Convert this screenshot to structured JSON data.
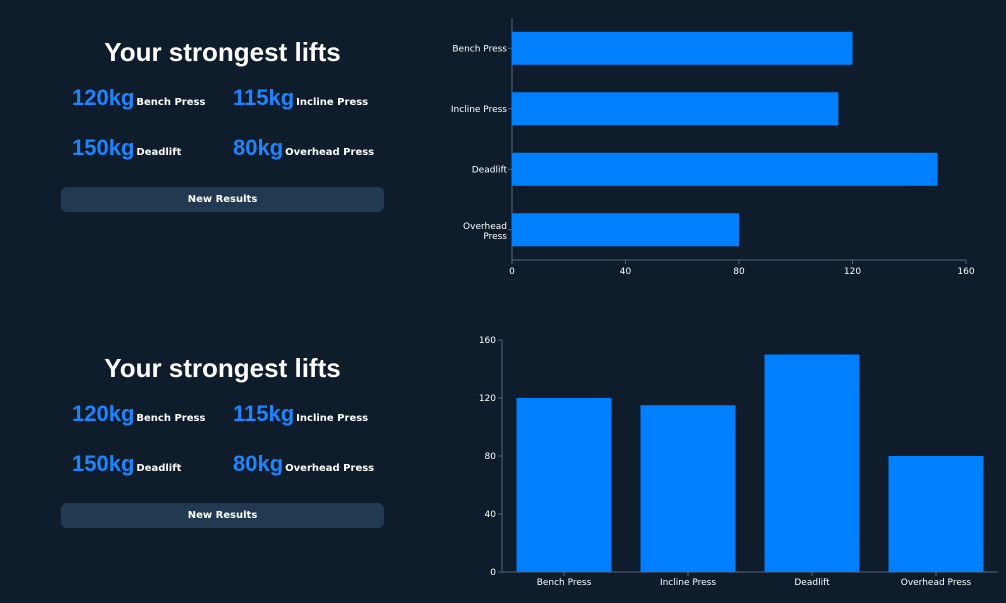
{
  "panels": [
    {
      "title": "Your strongest lifts",
      "lifts": [
        {
          "value": "120kg",
          "name": "Bench Press"
        },
        {
          "value": "115kg",
          "name": "Incline Press"
        },
        {
          "value": "150kg",
          "name": "Deadlift"
        },
        {
          "value": "80kg",
          "name": "Overhead Press"
        }
      ],
      "button_label": "New Results"
    },
    {
      "title": "Your strongest lifts",
      "lifts": [
        {
          "value": "120kg",
          "name": "Bench Press"
        },
        {
          "value": "115kg",
          "name": "Incline Press"
        },
        {
          "value": "150kg",
          "name": "Deadlift"
        },
        {
          "value": "80kg",
          "name": "Overhead Press"
        }
      ],
      "button_label": "New Results"
    }
  ],
  "colors": {
    "background": "#0f1c2c",
    "accent": "#1b86ff",
    "bar": "#0080ff",
    "button": "#213a52"
  },
  "chart_data": [
    {
      "type": "bar",
      "orientation": "horizontal",
      "categories": [
        "Bench Press",
        "Incline Press",
        "Deadlift",
        "Overhead Press"
      ],
      "values": [
        120,
        115,
        150,
        80
      ],
      "xlim": [
        0,
        160
      ],
      "ticks": [
        0,
        40,
        80,
        120,
        160
      ],
      "title": "",
      "xlabel": "",
      "ylabel": "",
      "grid": false
    },
    {
      "type": "bar",
      "orientation": "vertical",
      "categories": [
        "Bench Press",
        "Incline Press",
        "Deadlift",
        "Overhead Press"
      ],
      "values": [
        120,
        115,
        150,
        80
      ],
      "ylim": [
        0,
        160
      ],
      "ticks": [
        0,
        40,
        80,
        120,
        160
      ],
      "title": "",
      "xlabel": "",
      "ylabel": "",
      "grid": false
    }
  ]
}
